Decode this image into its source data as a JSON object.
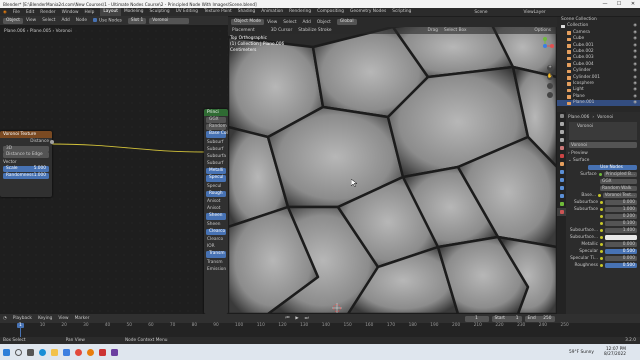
{
  "window": {
    "title": "Blender* [E:\\BlenderMania2d.com\\New Courses\\1 - Ultimate Nodes Course\\2 - Principled Node With Images\\Scene.blend]",
    "controls": [
      "—",
      "☐",
      "✕"
    ]
  },
  "menubar": {
    "menus": [
      "File",
      "Edit",
      "Render",
      "Window",
      "Help"
    ],
    "workspaces": [
      "Layout",
      "Modeling",
      "Sculpting",
      "UV Editing",
      "Texture Paint",
      "Shading",
      "Animation",
      "Rendering",
      "Compositing",
      "Geometry Nodes",
      "Scripting"
    ],
    "active_workspace": "Layout",
    "scene": "Scene",
    "view_layer": "ViewLayer"
  },
  "node_editor": {
    "header": {
      "editor": "Object",
      "menus": [
        "View",
        "Select",
        "Add",
        "Node"
      ],
      "use_nodes_label": "Use Nodes",
      "slot": "Slot 1",
      "material": "Voronoi"
    },
    "breadcrumb": [
      "Plane.006",
      "Plane.005",
      "Voronoi"
    ],
    "voronoi_node": {
      "title": "Voronoi Texture",
      "output": "Distance",
      "dimensions": "3D",
      "feature": "Distance to Edge",
      "input_label": "Vector",
      "scale_label": "Scale",
      "scale_value": "5.000",
      "randomness_label": "Randomness",
      "randomness_value": "1.000"
    },
    "principled_node": {
      "title": "Princi",
      "rows": [
        "GGX",
        "Random",
        "Base Col",
        "Subsurf",
        "Subsurf",
        "Subsurfa",
        "Subsurf",
        "Metalli",
        "Specul",
        "Specul",
        "Rough",
        "Anisot",
        "Anisot",
        "Sheen",
        "Sheen",
        "Clearco",
        "Clearco",
        "IOR",
        "Transm",
        "Transm",
        "Emission"
      ]
    }
  },
  "viewport": {
    "header": {
      "mode": "Object Mode",
      "menus": [
        "View",
        "Select",
        "Add",
        "Object"
      ],
      "transform": "Global"
    },
    "header2": {
      "tools": [
        "Placement",
        "3D Cursor",
        "Stabilize Stroke"
      ],
      "drag": "Drag",
      "select": "Select Box",
      "options": "Options"
    },
    "overlay_text": [
      "Top Orthographic",
      "(1) Collection | Plane.006",
      "Centimeters"
    ]
  },
  "outliner": {
    "title": "Scene Collection",
    "items": [
      "Collection",
      "Camera",
      "Cube",
      "Cube.001",
      "Cube.002",
      "Cube.003",
      "Cube.004",
      "Cylinder",
      "Cylinder.001",
      "Icosphere",
      "Light",
      "Plane",
      "Plane.001"
    ]
  },
  "properties": {
    "object_label": "Plane.006",
    "material": "Voronoi",
    "slot_label": "Voronoi",
    "sections": {
      "preview": "Preview",
      "surface": "Surface"
    },
    "use_nodes": "Use Nodes",
    "surface_value": "Principled B...",
    "distribution": "GGX",
    "subsurface_method": "Random Walk",
    "base_color_label": "Base...",
    "base_color_value": "Voronoi Text...",
    "fields": [
      {
        "label": "Subsurface",
        "value": "0.000"
      },
      {
        "label": "Subsurface",
        "value": "1.000"
      },
      {
        "label": "",
        "value": "0.200"
      },
      {
        "label": "",
        "value": "0.100"
      },
      {
        "label": "Subsurface...",
        "value": "1.400"
      },
      {
        "label": "Subsurface...",
        "value": ""
      },
      {
        "label": "Metallic",
        "value": "0.000"
      },
      {
        "label": "Specular",
        "value": "0.500"
      },
      {
        "label": "Specular Ti...",
        "value": "0.000"
      },
      {
        "label": "Roughness",
        "value": "0.500"
      }
    ]
  },
  "timeline": {
    "header": {
      "menus": [
        "Playback",
        "Keying",
        "View",
        "Marker"
      ],
      "current_frame": "1",
      "start_label": "Start",
      "start": "1",
      "end_label": "End",
      "end": "250"
    },
    "ticks": [
      "0",
      "10",
      "20",
      "30",
      "40",
      "50",
      "60",
      "70",
      "80",
      "90",
      "100",
      "110",
      "120",
      "130",
      "140",
      "150",
      "160",
      "170",
      "180",
      "190",
      "200",
      "210",
      "220",
      "230",
      "240",
      "250"
    ]
  },
  "statusbar": {
    "items": [
      "Box Select",
      "Pan View",
      "Node Context Menu"
    ],
    "version": "3.2.0"
  },
  "taskbar": {
    "weather": "59°F",
    "weather_desc": "Sunny",
    "time": "12:07 PM",
    "date": "8/27/2022"
  },
  "colors": {
    "accent": "#4772b3",
    "voronoi_header": "#7a4a22",
    "principled_header": "#2f6b33",
    "selected_text": "#e59f5e"
  }
}
